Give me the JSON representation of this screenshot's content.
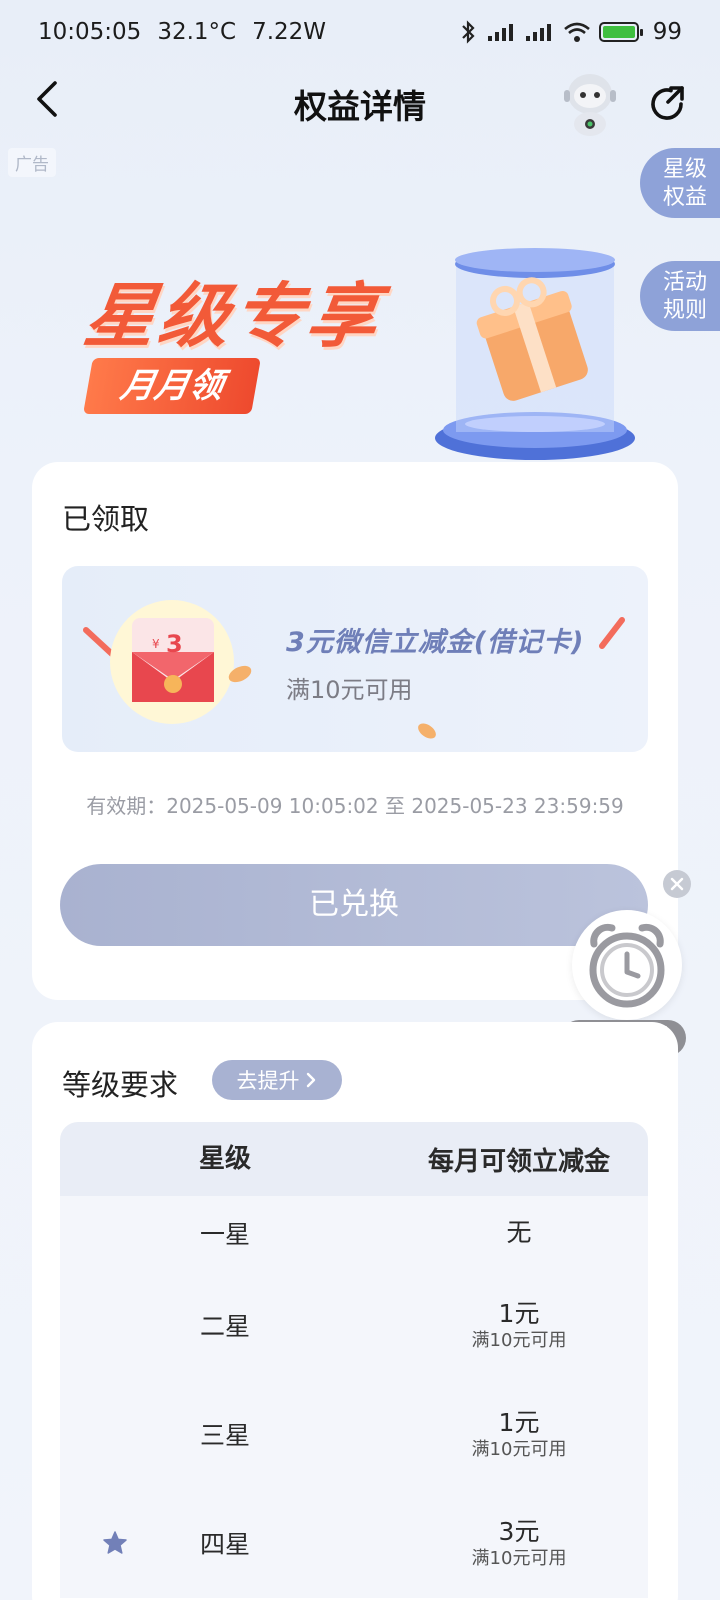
{
  "status_bar": {
    "time": "10:05:05",
    "temperature": "32.1°C",
    "power": "7.22W",
    "battery": "99"
  },
  "nav": {
    "title": "权益详情"
  },
  "ad_tag": "广告",
  "side_tabs": {
    "star_benefits": "星级权益",
    "activity_rules": "活动规则"
  },
  "hero": {
    "title": "星级专享",
    "subtitle": "月月领"
  },
  "claimed": {
    "heading": "已领取",
    "coupon_name": "3元微信立减金(借记卡)",
    "coupon_condition": "满10元可用",
    "coupon_badge_value": "3",
    "validity": "有效期：2025-05-09 10:05:02 至 2025-05-23 23:59:59",
    "button_label": "已兑换"
  },
  "reminder": {
    "label": "查看提醒"
  },
  "level_requirements": {
    "heading": "等级要求",
    "upgrade_label": "去提升",
    "columns": [
      "星级",
      "每月可领立减金"
    ],
    "rows": [
      {
        "level": "一星",
        "amount": "无",
        "condition": "",
        "current": false
      },
      {
        "level": "二星",
        "amount": "1元",
        "condition": "满10元可用",
        "current": false
      },
      {
        "level": "三星",
        "amount": "1元",
        "condition": "满10元可用",
        "current": false
      },
      {
        "level": "四星",
        "amount": "3元",
        "condition": "满10元可用",
        "current": true
      }
    ]
  },
  "colors": {
    "accent": "#f25a38",
    "primary_muted": "#8ea2d8",
    "coupon_text": "#6f7fb8"
  }
}
